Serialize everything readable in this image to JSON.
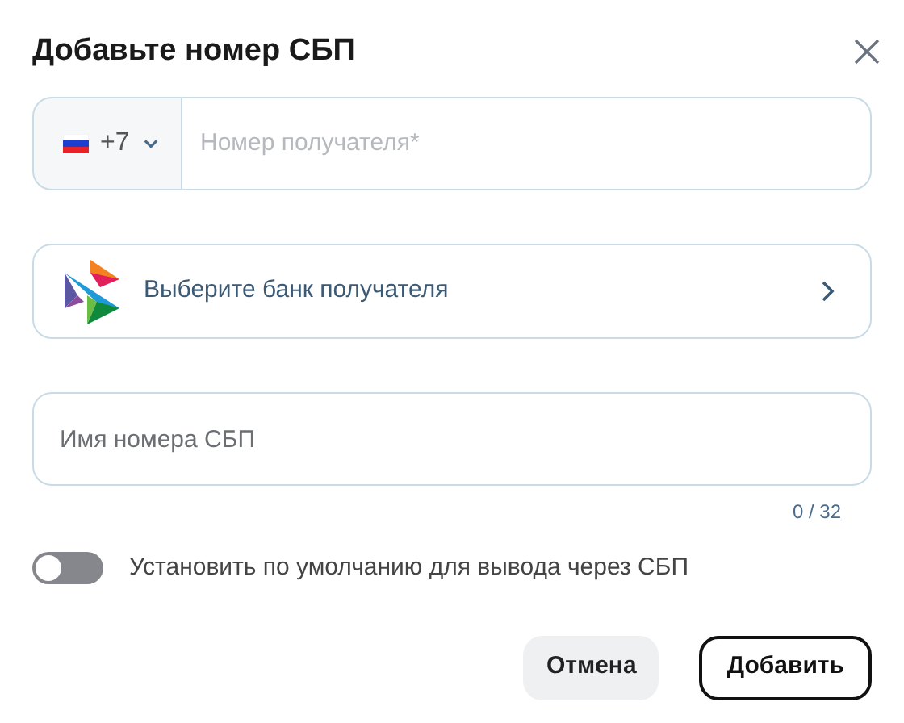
{
  "dialog": {
    "title": "Добавьте номер СБП"
  },
  "phone": {
    "country_code": "+7",
    "placeholder": "Номер получателя*"
  },
  "bank": {
    "label": "Выберите банк получателя"
  },
  "name_field": {
    "placeholder": "Имя номера СБП",
    "counter": "0 / 32"
  },
  "default_toggle": {
    "label": "Установить по умолчанию для вывода через СБП",
    "on": false
  },
  "buttons": [
    {
      "label": "Отмена",
      "kind": "secondary"
    },
    {
      "label": "Добавить",
      "kind": "primary"
    }
  ]
}
